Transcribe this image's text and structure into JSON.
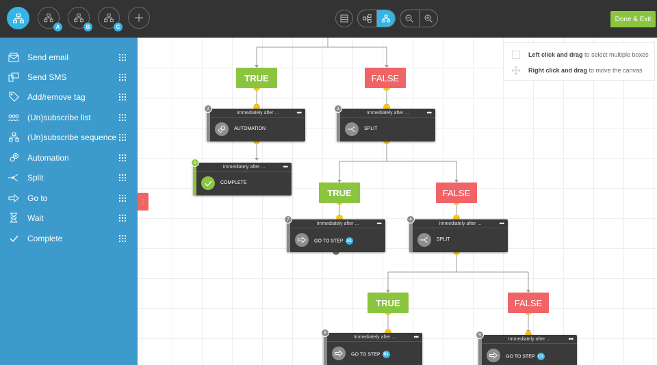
{
  "toolbar": {
    "left_icons": [
      {
        "icon": "sitemap-icon",
        "active": true,
        "badge": ""
      },
      {
        "icon": "sitemap-icon",
        "active": false,
        "badge": "A"
      },
      {
        "icon": "sitemap-icon",
        "active": false,
        "badge": "B"
      },
      {
        "icon": "sitemap-icon",
        "active": false,
        "badge": "C"
      },
      {
        "icon": "plus-icon",
        "active": false,
        "badge": ""
      }
    ],
    "done_label": "Done & Exit"
  },
  "sidebar": {
    "items": [
      {
        "label": "Send email",
        "icon": "email-icon"
      },
      {
        "label": "Send SMS",
        "icon": "sms-icon"
      },
      {
        "label": "Add/remove tag",
        "icon": "tag-icon"
      },
      {
        "label": "(Un)subscribe list",
        "icon": "list-icon"
      },
      {
        "label": "(Un)subscribe sequence",
        "icon": "sequence-icon"
      },
      {
        "label": "Automation",
        "icon": "automation-icon"
      },
      {
        "label": "Split",
        "icon": "split-icon"
      },
      {
        "label": "Go to",
        "icon": "arrow-right-icon"
      },
      {
        "label": "Wait",
        "icon": "hourglass-icon"
      },
      {
        "label": "Complete",
        "icon": "check-icon"
      }
    ]
  },
  "help": {
    "select_bold": "Left click and drag",
    "select_rest": " to select multiple boxes",
    "move_bold": "Right click and drag",
    "move_rest": " to move the canvas"
  },
  "branches": {
    "true_label": "TRUE",
    "false_label": "FALSE"
  },
  "nodes": {
    "n2": {
      "number": "2",
      "header": "Immediately after ...",
      "label": "AUTOMATION",
      "badge": ""
    },
    "n3": {
      "number": "3",
      "header": "Immediately after ...",
      "label": "SPLIT",
      "badge": ""
    },
    "n6": {
      "number": "6",
      "header": "Immediately after ...",
      "label": "COMPLETE",
      "badge": ""
    },
    "n7": {
      "number": "7",
      "header": "Immediately after ...",
      "label": "GO TO STEP",
      "badge": "A1"
    },
    "n4": {
      "number": "4",
      "header": "Immediately after ...",
      "label": "SPLIT",
      "badge": ""
    },
    "n8": {
      "number": "8",
      "header": "Immediately after ...",
      "label": "GO TO STEP",
      "badge": "B1"
    },
    "n9": {
      "number": "9",
      "header": "Immediately after ...",
      "label": "GO TO STEP",
      "badge": "C1"
    }
  },
  "colors": {
    "accent": "#35b5e5",
    "sidebar": "#3c9bcc",
    "true": "#8bc53f",
    "false": "#f06467",
    "connector": "#f5c518"
  }
}
